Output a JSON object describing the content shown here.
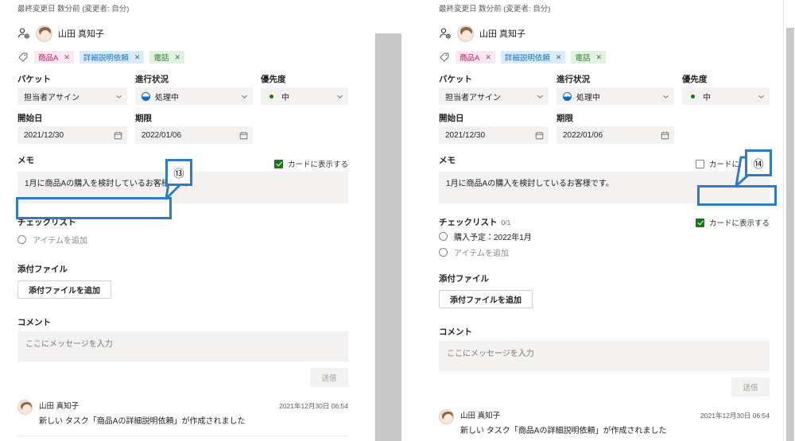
{
  "meta": {
    "last_modified": "最終変更日 数分前 (変更者: 自分)"
  },
  "assignee": {
    "icon": "person-add-icon",
    "avatar_icon": "avatar",
    "name": "山田 真知子"
  },
  "tags": {
    "icon": "tag-icon",
    "items": [
      {
        "label": "商品A",
        "remove": "✕",
        "bg": "#fde7f3",
        "color": "#c2185b"
      },
      {
        "label": "詳細説明依頼",
        "remove": "✕",
        "bg": "#d9ecfb",
        "color": "#1f6fb2"
      },
      {
        "label": "電話",
        "remove": "✕",
        "bg": "#dff3df",
        "color": "#2e7d32"
      }
    ]
  },
  "fields": {
    "bucket": {
      "label": "バケット",
      "value": "担当者アサイン"
    },
    "progress": {
      "label": "進行状況",
      "value": "処理中",
      "icon": "half-filled-circle-icon"
    },
    "priority": {
      "label": "優先度",
      "value": "中",
      "icon": "priority-dot-icon"
    },
    "start_date": {
      "label": "開始日",
      "value": "2021/12/30",
      "icon": "calendar-icon"
    },
    "due_date": {
      "label": "期限",
      "value": "2022/01/06",
      "icon": "calendar-icon"
    },
    "chevron": "chevron-down-icon"
  },
  "memo": {
    "label": "メモ",
    "text": "1月に商品Aの購入を検討しているお客様です。",
    "show_on_card_label": "カードに表示する",
    "left_checked": true,
    "right_checked": false
  },
  "checklist": {
    "label": "チェックリスト",
    "count_right": "0/1",
    "add_item_placeholder": "アイテムを追加",
    "right_items": [
      {
        "text": "購入予定：2022年1月",
        "checked": false
      }
    ],
    "show_on_card_label": "カードに表示する",
    "right_show_on_card_checked": true
  },
  "attachments": {
    "label": "添付ファイル",
    "add_button": "添付ファイルを追加"
  },
  "comments": {
    "label": "コメント",
    "placeholder": "ここにメッセージを入力",
    "send_button": "送信",
    "activity": {
      "author": "山田 真知子",
      "timestamp": "2021年12月30日 06:54",
      "text": "新しい タスク「商品Aの詳細説明依頼」が作成されました"
    }
  },
  "annotations": {
    "left": {
      "number": "⑬",
      "target": "checklist-add-item-field"
    },
    "right": {
      "number": "⑭",
      "target": "checklist-show-on-card-checkbox"
    },
    "color": "#2e7cc4"
  }
}
